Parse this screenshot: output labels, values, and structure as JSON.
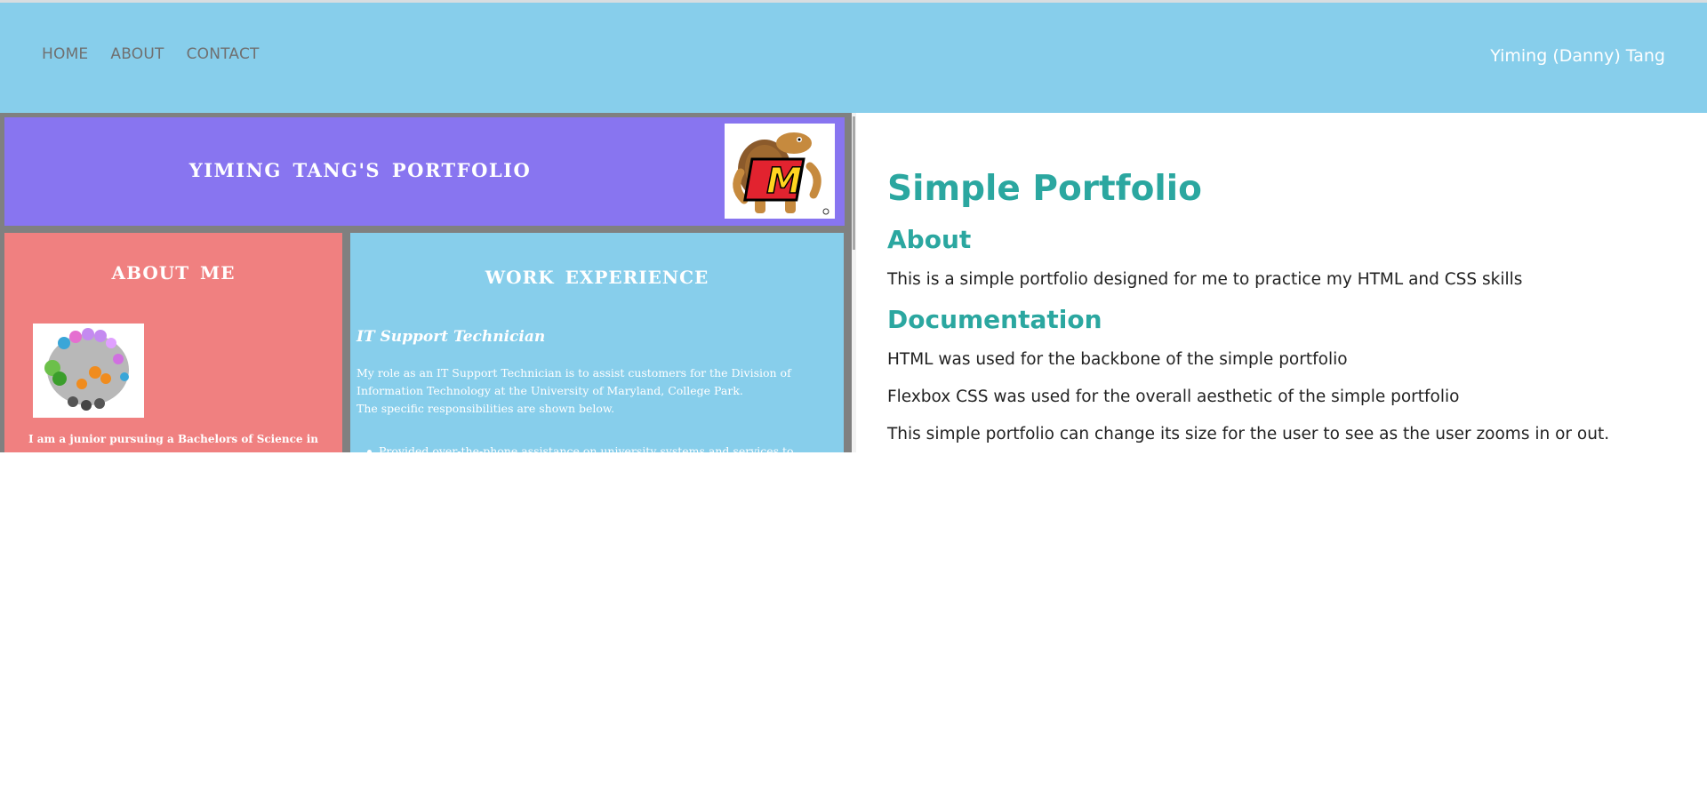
{
  "nav": {
    "links": [
      "HOME",
      "ABOUT",
      "CONTACT"
    ],
    "brand": "Yiming (Danny) Tang"
  },
  "preview": {
    "title": "YIMING TANG'S PORTFOLIO",
    "about_title": "ABOUT ME",
    "about_text": "I am a junior pursuing a Bachelors of Science in",
    "work_title": "WORK EXPERIENCE",
    "job_title": "IT Support Technician",
    "work_lines": [
      "My role as an IT Support Technician is to assist customers for the Division of",
      "Information Technology at the University of Maryland, College Park.",
      "The specific responsibilities are shown below."
    ],
    "bullet": "Provided over-the-phone assistance on university systems and services to",
    "logo_letter": "M"
  },
  "content": {
    "title": "Simple Portfolio",
    "about_heading": "About",
    "about_text": "This is a simple portfolio designed for me to practice my HTML and CSS skills",
    "doc_heading": "Documentation",
    "doc_items": [
      "HTML was used for the backbone of the simple portfolio",
      "Flexbox CSS was used for the overall aesthetic of the simple portfolio",
      "This simple portfolio can change its size for the user to see as the user zooms in or out."
    ]
  },
  "colors": {
    "navbar": "#87ceeb",
    "accent": "#2ba7a0",
    "preview_header": "#8875f0",
    "preview_about": "#f08080",
    "preview_work": "#87ceeb"
  }
}
